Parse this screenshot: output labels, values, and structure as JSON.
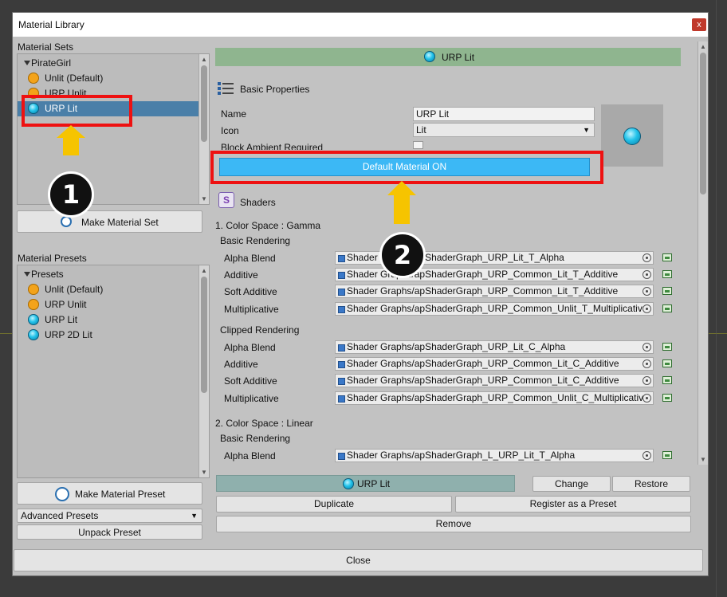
{
  "window": {
    "title": "Material Library",
    "close_glyph": "x"
  },
  "left": {
    "material_sets_label": "Material Sets",
    "sets_tree": {
      "root": "PirateGirl",
      "items": [
        {
          "label": "Unlit (Default)",
          "icon": "orange-circle-icon"
        },
        {
          "label": "URP Unlit",
          "icon": "orange-circle-icon"
        },
        {
          "label": "URP Lit",
          "icon": "cyan-sphere-icon",
          "selected": true
        }
      ]
    },
    "make_material_set": "Make Material Set",
    "material_presets_label": "Material Presets",
    "presets_tree": {
      "root": "Presets",
      "items": [
        {
          "label": "Unlit (Default)",
          "icon": "orange-circle-icon"
        },
        {
          "label": "URP Unlit",
          "icon": "orange-circle-icon"
        },
        {
          "label": "URP Lit",
          "icon": "cyan-sphere-icon"
        },
        {
          "label": "URP 2D Lit",
          "icon": "cyan-sphere-icon"
        }
      ]
    },
    "make_material_preset": "Make Material Preset",
    "advanced_presets": "Advanced Presets",
    "unpack_preset": "Unpack Preset"
  },
  "right": {
    "header_title": "URP Lit",
    "basic_properties": "Basic Properties",
    "name_label": "Name",
    "name_value": "URP Lit",
    "icon_label": "Icon",
    "icon_value": "Lit",
    "block_ambient_label": "Block Ambient Required",
    "default_material_btn": "Default Material ON",
    "shaders_label": "Shaders",
    "gamma_heading": "1. Color Space : Gamma",
    "basic_rendering": "Basic Rendering",
    "clipped_rendering": "Clipped Rendering",
    "linear_heading": "2. Color Space : Linear",
    "gamma_basic": [
      {
        "label": "Alpha Blend",
        "value": "Shader Graphs/apShaderGraph_URP_Lit_T_Alpha"
      },
      {
        "label": "Additive",
        "value": "Shader Graphs/apShaderGraph_URP_Common_Lit_T_Additive"
      },
      {
        "label": "Soft Additive",
        "value": "Shader Graphs/apShaderGraph_URP_Common_Lit_T_Additive"
      },
      {
        "label": "Multiplicative",
        "value": "Shader Graphs/apShaderGraph_URP_Common_Unlit_T_Multiplicative"
      }
    ],
    "gamma_clipped": [
      {
        "label": "Alpha Blend",
        "value": "Shader Graphs/apShaderGraph_URP_Lit_C_Alpha"
      },
      {
        "label": "Additive",
        "value": "Shader Graphs/apShaderGraph_URP_Common_Lit_C_Additive"
      },
      {
        "label": "Soft Additive",
        "value": "Shader Graphs/apShaderGraph_URP_Common_Lit_C_Additive"
      },
      {
        "label": "Multiplicative",
        "value": "Shader Graphs/apShaderGraph_URP_Common_Unlit_C_Multiplicative"
      }
    ],
    "linear_basic": [
      {
        "label": "Alpha Blend",
        "value": "Shader Graphs/apShaderGraph_L_URP_Lit_T_Alpha"
      }
    ]
  },
  "bottom": {
    "current_label": "URP Lit",
    "change": "Change",
    "restore": "Restore",
    "duplicate": "Duplicate",
    "register": "Register as a Preset",
    "remove": "Remove",
    "close": "Close"
  },
  "callouts": {
    "one": "1",
    "two": "2"
  },
  "colors": {
    "header_green": "#8fb58f",
    "selected_blue": "#4a7fa8",
    "default_btn": "#3cb8f5",
    "highlight_red": "#ee1111",
    "arrow_yellow": "#f6c400"
  }
}
